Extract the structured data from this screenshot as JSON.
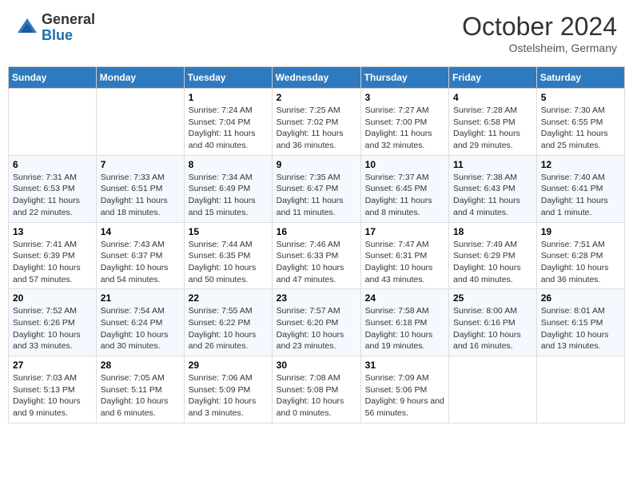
{
  "header": {
    "logo_general": "General",
    "logo_blue": "Blue",
    "month_title": "October 2024",
    "location": "Ostelsheim, Germany"
  },
  "weekdays": [
    "Sunday",
    "Monday",
    "Tuesday",
    "Wednesday",
    "Thursday",
    "Friday",
    "Saturday"
  ],
  "weeks": [
    [
      {
        "day": "",
        "info": ""
      },
      {
        "day": "",
        "info": ""
      },
      {
        "day": "1",
        "info": "Sunrise: 7:24 AM\nSunset: 7:04 PM\nDaylight: 11 hours and 40 minutes."
      },
      {
        "day": "2",
        "info": "Sunrise: 7:25 AM\nSunset: 7:02 PM\nDaylight: 11 hours and 36 minutes."
      },
      {
        "day": "3",
        "info": "Sunrise: 7:27 AM\nSunset: 7:00 PM\nDaylight: 11 hours and 32 minutes."
      },
      {
        "day": "4",
        "info": "Sunrise: 7:28 AM\nSunset: 6:58 PM\nDaylight: 11 hours and 29 minutes."
      },
      {
        "day": "5",
        "info": "Sunrise: 7:30 AM\nSunset: 6:55 PM\nDaylight: 11 hours and 25 minutes."
      }
    ],
    [
      {
        "day": "6",
        "info": "Sunrise: 7:31 AM\nSunset: 6:53 PM\nDaylight: 11 hours and 22 minutes."
      },
      {
        "day": "7",
        "info": "Sunrise: 7:33 AM\nSunset: 6:51 PM\nDaylight: 11 hours and 18 minutes."
      },
      {
        "day": "8",
        "info": "Sunrise: 7:34 AM\nSunset: 6:49 PM\nDaylight: 11 hours and 15 minutes."
      },
      {
        "day": "9",
        "info": "Sunrise: 7:35 AM\nSunset: 6:47 PM\nDaylight: 11 hours and 11 minutes."
      },
      {
        "day": "10",
        "info": "Sunrise: 7:37 AM\nSunset: 6:45 PM\nDaylight: 11 hours and 8 minutes."
      },
      {
        "day": "11",
        "info": "Sunrise: 7:38 AM\nSunset: 6:43 PM\nDaylight: 11 hours and 4 minutes."
      },
      {
        "day": "12",
        "info": "Sunrise: 7:40 AM\nSunset: 6:41 PM\nDaylight: 11 hours and 1 minute."
      }
    ],
    [
      {
        "day": "13",
        "info": "Sunrise: 7:41 AM\nSunset: 6:39 PM\nDaylight: 10 hours and 57 minutes."
      },
      {
        "day": "14",
        "info": "Sunrise: 7:43 AM\nSunset: 6:37 PM\nDaylight: 10 hours and 54 minutes."
      },
      {
        "day": "15",
        "info": "Sunrise: 7:44 AM\nSunset: 6:35 PM\nDaylight: 10 hours and 50 minutes."
      },
      {
        "day": "16",
        "info": "Sunrise: 7:46 AM\nSunset: 6:33 PM\nDaylight: 10 hours and 47 minutes."
      },
      {
        "day": "17",
        "info": "Sunrise: 7:47 AM\nSunset: 6:31 PM\nDaylight: 10 hours and 43 minutes."
      },
      {
        "day": "18",
        "info": "Sunrise: 7:49 AM\nSunset: 6:29 PM\nDaylight: 10 hours and 40 minutes."
      },
      {
        "day": "19",
        "info": "Sunrise: 7:51 AM\nSunset: 6:28 PM\nDaylight: 10 hours and 36 minutes."
      }
    ],
    [
      {
        "day": "20",
        "info": "Sunrise: 7:52 AM\nSunset: 6:26 PM\nDaylight: 10 hours and 33 minutes."
      },
      {
        "day": "21",
        "info": "Sunrise: 7:54 AM\nSunset: 6:24 PM\nDaylight: 10 hours and 30 minutes."
      },
      {
        "day": "22",
        "info": "Sunrise: 7:55 AM\nSunset: 6:22 PM\nDaylight: 10 hours and 26 minutes."
      },
      {
        "day": "23",
        "info": "Sunrise: 7:57 AM\nSunset: 6:20 PM\nDaylight: 10 hours and 23 minutes."
      },
      {
        "day": "24",
        "info": "Sunrise: 7:58 AM\nSunset: 6:18 PM\nDaylight: 10 hours and 19 minutes."
      },
      {
        "day": "25",
        "info": "Sunrise: 8:00 AM\nSunset: 6:16 PM\nDaylight: 10 hours and 16 minutes."
      },
      {
        "day": "26",
        "info": "Sunrise: 8:01 AM\nSunset: 6:15 PM\nDaylight: 10 hours and 13 minutes."
      }
    ],
    [
      {
        "day": "27",
        "info": "Sunrise: 7:03 AM\nSunset: 5:13 PM\nDaylight: 10 hours and 9 minutes."
      },
      {
        "day": "28",
        "info": "Sunrise: 7:05 AM\nSunset: 5:11 PM\nDaylight: 10 hours and 6 minutes."
      },
      {
        "day": "29",
        "info": "Sunrise: 7:06 AM\nSunset: 5:09 PM\nDaylight: 10 hours and 3 minutes."
      },
      {
        "day": "30",
        "info": "Sunrise: 7:08 AM\nSunset: 5:08 PM\nDaylight: 10 hours and 0 minutes."
      },
      {
        "day": "31",
        "info": "Sunrise: 7:09 AM\nSunset: 5:06 PM\nDaylight: 9 hours and 56 minutes."
      },
      {
        "day": "",
        "info": ""
      },
      {
        "day": "",
        "info": ""
      }
    ]
  ]
}
